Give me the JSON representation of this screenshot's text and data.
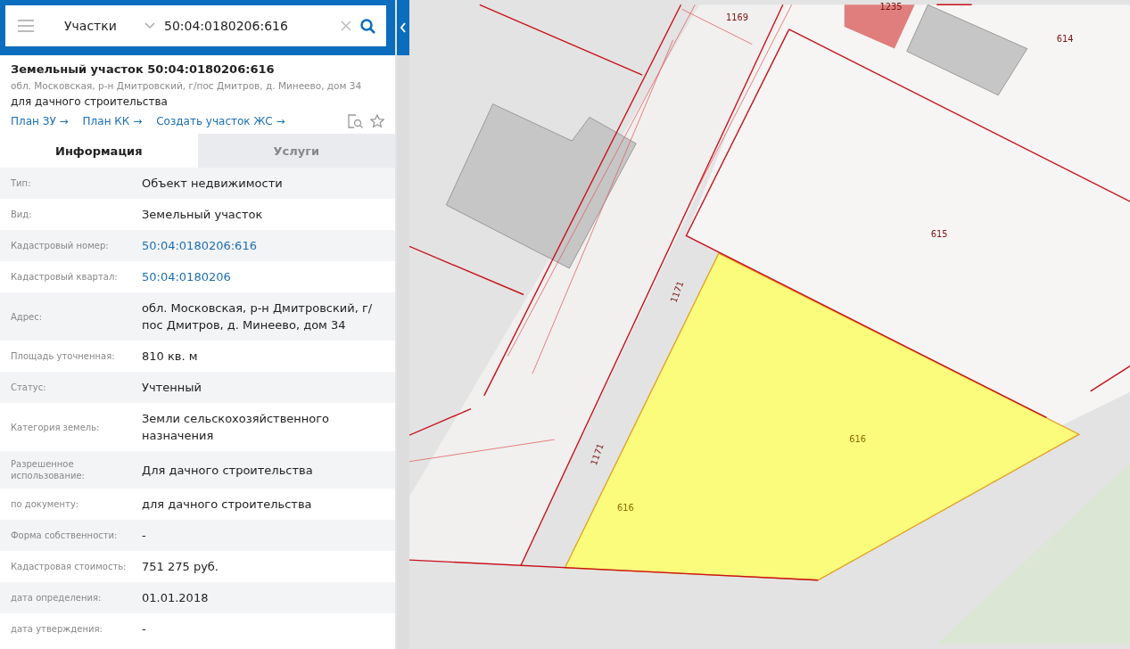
{
  "search": {
    "layer": "Участки",
    "value": "50:04:0180206:616"
  },
  "object": {
    "title": "Земельный участок 50:04:0180206:616",
    "address": "обл. Московская, р-н Дмитровский, г/пос Дмитров, д. Минеево, дом 34",
    "purpose": "для дачного строительства"
  },
  "links": [
    "План ЗУ →",
    "План КК →",
    "Создать участок ЖС →"
  ],
  "tabs": [
    {
      "label": "Информация",
      "selected": true
    },
    {
      "label": "Услуги",
      "selected": false
    }
  ],
  "rows": [
    {
      "label": "Тип:",
      "value": "Объект недвижимости",
      "kind": "text"
    },
    {
      "label": "Вид:",
      "value": "Земельный участок",
      "kind": "text"
    },
    {
      "label": "Кадастровый номер:",
      "value": "50:04:0180206:616",
      "kind": "link"
    },
    {
      "label": "Кадастровый квартал:",
      "value": "50:04:0180206",
      "kind": "link"
    },
    {
      "label": "Адрес:",
      "value": "обл. Московская, р-н Дмитровский, г/пос Дмитров, д. Минеево, дом 34",
      "kind": "text"
    },
    {
      "label": "Площадь уточненная:",
      "value": "810 кв. м",
      "kind": "text"
    },
    {
      "label": "Статус:",
      "value": "Учтенный",
      "kind": "text"
    },
    {
      "label": "Категория земель:",
      "value": "Земли сельскохозяйственного назначения",
      "kind": "text"
    },
    {
      "label": "Разрешенное использование:",
      "value": "Для дачного строительства",
      "kind": "text"
    },
    {
      "label": "по документу:",
      "value": "для дачного строительства",
      "kind": "text"
    },
    {
      "label": "Форма собственности:",
      "value": "-",
      "kind": "text"
    },
    {
      "label": "Кадастровая стоимость:",
      "value": "751 275 руб.",
      "kind": "text"
    },
    {
      "label": "дата определения:",
      "value": "01.01.2018",
      "kind": "text"
    },
    {
      "label": "дата утверждения:",
      "value": "-",
      "kind": "text"
    }
  ],
  "map": {
    "labels": [
      "1169",
      "1235",
      "614",
      "615",
      "1171",
      "1171",
      "616",
      "616"
    ]
  }
}
